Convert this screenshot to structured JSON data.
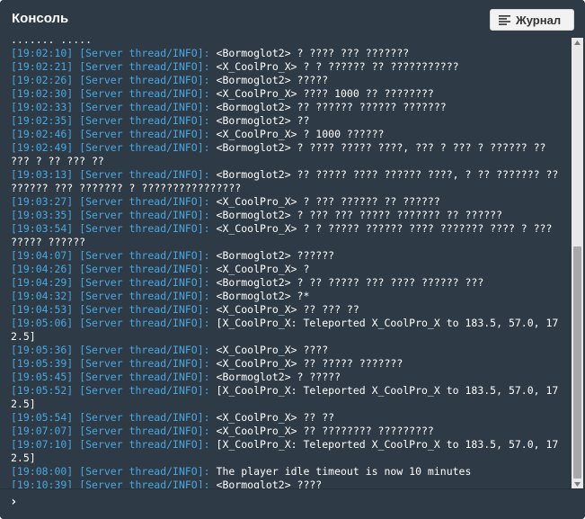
{
  "header": {
    "title": "Консоль",
    "journal_button": "Журнал",
    "journal_icon": "list-icon"
  },
  "colors": {
    "background": "#2e3a45",
    "timestamp": "#4aa8e0",
    "text": "#ffffff"
  },
  "log": {
    "partial_top": "....... .....",
    "entries": [
      {
        "ts": "[19:02:10]",
        "src": "[Server thread/INFO]:",
        "msg": "<Bormoglot2> ? ???? ??? ???????"
      },
      {
        "ts": "[19:02:21]",
        "src": "[Server thread/INFO]:",
        "msg": "<X_CoolPro_X> ? ? ?????? ?? ???????????"
      },
      {
        "ts": "[19:02:26]",
        "src": "[Server thread/INFO]:",
        "msg": "<Bormoglot2> ?????"
      },
      {
        "ts": "[19:02:30]",
        "src": "[Server thread/INFO]:",
        "msg": "<X_CoolPro_X> ???? 1000 ?? ????????"
      },
      {
        "ts": "[19:02:33]",
        "src": "[Server thread/INFO]:",
        "msg": "<Bormoglot2> ?? ?????? ?????? ???????"
      },
      {
        "ts": "[19:02:35]",
        "src": "[Server thread/INFO]:",
        "msg": "<Bormoglot2> ??"
      },
      {
        "ts": "[19:02:46]",
        "src": "[Server thread/INFO]:",
        "msg": "<X_CoolPro_X> ? 1000 ??????"
      },
      {
        "ts": "[19:02:49]",
        "src": "[Server thread/INFO]:",
        "msg": "<Bormoglot2> ? ???? ????? ????, ??? ? ??? ? ?????? ?? ??? ? ?? ??? ??"
      },
      {
        "ts": "[19:03:13]",
        "src": "[Server thread/INFO]:",
        "msg": "<Bormoglot2> ?? ????? ???? ?????? ????, ? ?? ??????? ?? ?????? ??? ??????? ? ????????????????"
      },
      {
        "ts": "[19:03:27]",
        "src": "[Server thread/INFO]:",
        "msg": "<X_CoolPro_X> ? ??? ?????? ?? ??????"
      },
      {
        "ts": "[19:03:35]",
        "src": "[Server thread/INFO]:",
        "msg": "<Bormoglot2> ? ??? ??? ????? ??????? ?? ??????"
      },
      {
        "ts": "[19:03:54]",
        "src": "[Server thread/INFO]:",
        "msg": "<X_CoolPro_X> ? ? ????? ?????? ???? ??????? ???? ? ??? ????? ??????"
      },
      {
        "ts": "[19:04:07]",
        "src": "[Server thread/INFO]:",
        "msg": "<Bormoglot2> ??????"
      },
      {
        "ts": "[19:04:26]",
        "src": "[Server thread/INFO]:",
        "msg": "<X_CoolPro_X> ?"
      },
      {
        "ts": "[19:04:29]",
        "src": "[Server thread/INFO]:",
        "msg": "<Bormoglot2> ? ?? ????? ??? ???? ?????? ???"
      },
      {
        "ts": "[19:04:32]",
        "src": "[Server thread/INFO]:",
        "msg": "<Bormoglot2> ?*"
      },
      {
        "ts": "[19:04:53]",
        "src": "[Server thread/INFO]:",
        "msg": "<X_CoolPro_X> ?? ??? ??"
      },
      {
        "ts": "[19:05:06]",
        "src": "[Server thread/INFO]:",
        "msg": "[X_CoolPro_X: Teleported X_CoolPro_X to 183.5, 57.0, 172.5]"
      },
      {
        "ts": "[19:05:36]",
        "src": "[Server thread/INFO]:",
        "msg": "<X_CoolPro_X> ????"
      },
      {
        "ts": "[19:05:39]",
        "src": "[Server thread/INFO]:",
        "msg": "<X_CoolPro_X> ?? ????? ???????"
      },
      {
        "ts": "[19:05:45]",
        "src": "[Server thread/INFO]:",
        "msg": "<Bormoglot2> ? ?????"
      },
      {
        "ts": "[19:05:52]",
        "src": "[Server thread/INFO]:",
        "msg": "[X_CoolPro_X: Teleported X_CoolPro_X to 183.5, 57.0, 172.5]"
      },
      {
        "ts": "[19:05:54]",
        "src": "[Server thread/INFO]:",
        "msg": "<X_CoolPro_X> ?? ??"
      },
      {
        "ts": "[19:07:07]",
        "src": "[Server thread/INFO]:",
        "msg": "<X_CoolPro_X> ?? ???????? ?????????"
      },
      {
        "ts": "[19:07:10]",
        "src": "[Server thread/INFO]:",
        "msg": "[X_CoolPro_X: Teleported X_CoolPro_X to 183.5, 57.0, 172.5]"
      },
      {
        "ts": "[19:08:00]",
        "src": "[Server thread/INFO]:",
        "msg": "The player idle timeout is now 10 minutes"
      },
      {
        "ts": "[19:10:39]",
        "src": "[Server thread/INFO]:",
        "msg": "<Bormoglot2> ????"
      }
    ]
  },
  "input": {
    "prompt_icon": "chevron-right-icon",
    "prompt_glyph": "›",
    "value": ""
  }
}
